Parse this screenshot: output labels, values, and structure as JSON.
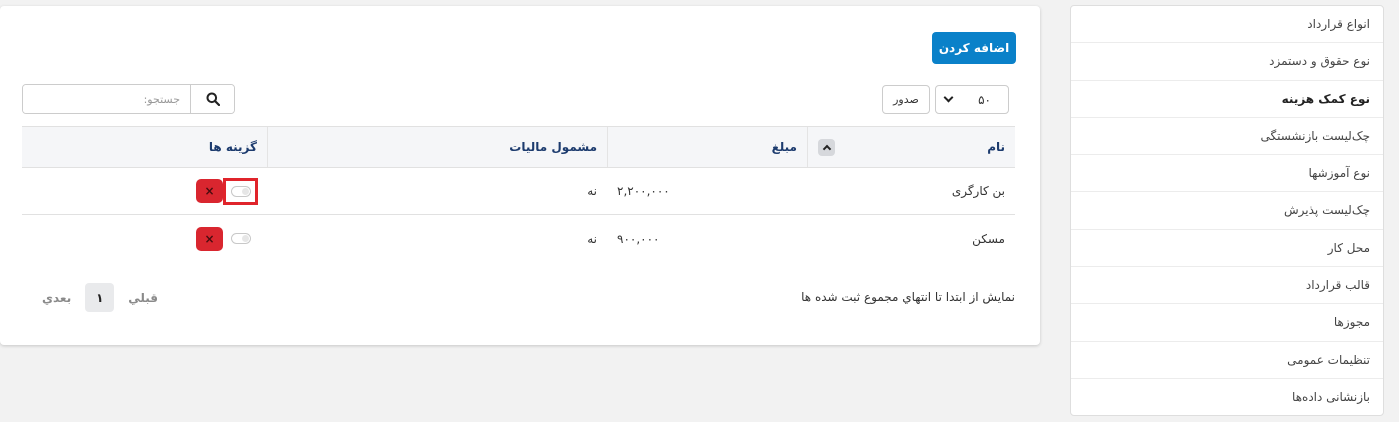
{
  "sidebar": {
    "items": [
      {
        "label": "انواع قرارداد",
        "active": false
      },
      {
        "label": "نوع حقوق و دستمزد",
        "active": false
      },
      {
        "label": "نوع کمک هزینه",
        "active": true
      },
      {
        "label": "چک‌لیست بازنشستگی",
        "active": false
      },
      {
        "label": "نوع آموزشها",
        "active": false
      },
      {
        "label": "چک‌لیست پذیرش",
        "active": false
      },
      {
        "label": "محل کار",
        "active": false
      },
      {
        "label": "قالب قرارداد",
        "active": false
      },
      {
        "label": "مجوزها",
        "active": false
      },
      {
        "label": "تنظیمات عمومی",
        "active": false
      },
      {
        "label": "بازنشانی داده‌ها",
        "active": false
      }
    ]
  },
  "toolbar": {
    "add_label": "اضافه کردن",
    "page_size_value": "۵۰",
    "page_size_label": "صدور"
  },
  "search": {
    "placeholder": "جستجو:",
    "value": ""
  },
  "table": {
    "headers": {
      "name": "نام",
      "amount": "مبلغ",
      "tax": "مشمول مالیات",
      "options": "گزینه ها"
    },
    "rows": [
      {
        "name": "بن کارگری",
        "amount": "۲,۲۰۰,۰۰۰",
        "tax": "نه",
        "highlight": true
      },
      {
        "name": "مسکن",
        "amount": "۹۰۰,۰۰۰",
        "tax": "نه",
        "highlight": false
      }
    ],
    "delete_symbol": "×"
  },
  "footer": {
    "info": "نمایش از ابتدا تا انتهاي مجموع ثبت شده ها",
    "prev_label": "قبلي",
    "page": "۱",
    "next_label": "بعدي"
  },
  "colors": {
    "accent": "#0a81c9",
    "danger": "#d9262f",
    "highlight_frame": "#e0242b",
    "header_text": "#1c3b6e"
  }
}
